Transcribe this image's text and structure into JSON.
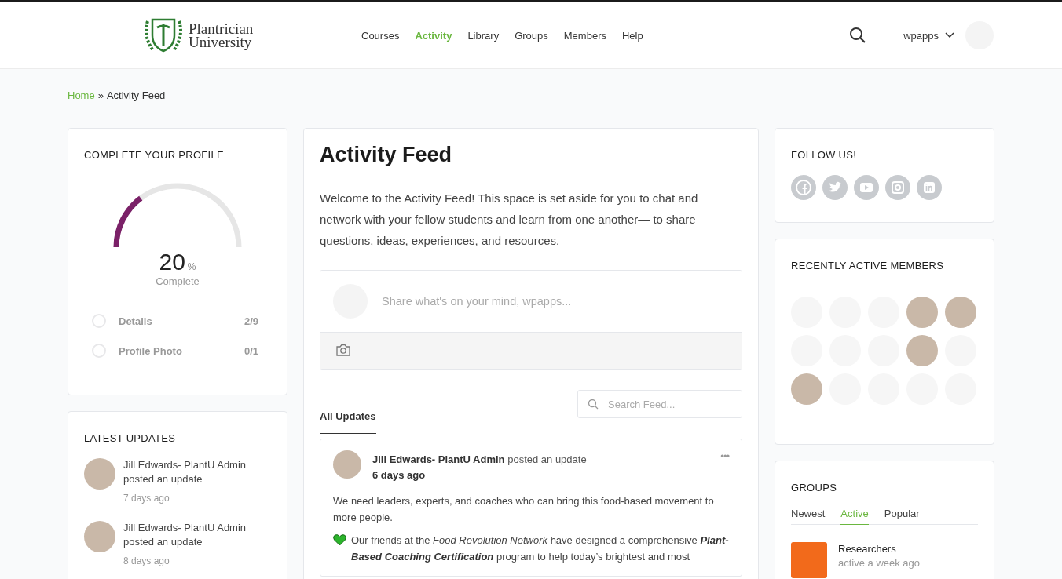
{
  "header": {
    "logo_line_1": "Plantrician",
    "logo_line_2": "University",
    "nav": [
      {
        "label": "Courses",
        "selected": false
      },
      {
        "label": "Activity",
        "selected": true
      },
      {
        "label": "Library",
        "selected": false
      },
      {
        "label": "Groups",
        "selected": false
      },
      {
        "label": "Members",
        "selected": false
      },
      {
        "label": "Help",
        "selected": false
      }
    ],
    "username": "wpapps"
  },
  "breadcrumb": {
    "home": "Home",
    "separator": "»",
    "current": "Activity Feed"
  },
  "profile_card": {
    "title": "COMPLETE YOUR PROFILE",
    "level": 0.2,
    "percent": "20",
    "percent_sign": "%",
    "caption": "Complete",
    "steps": [
      {
        "label": "Details",
        "count": "2/9",
        "done": false
      },
      {
        "label": "Profile Photo",
        "count": "0/1",
        "done": false
      }
    ]
  },
  "latest_updates": {
    "title": "LATEST UPDATES",
    "items": [
      {
        "name": "Jill Edwards- PlantU Admin",
        "action": "posted an update",
        "time": "7 days ago"
      },
      {
        "name": "Jill Edwards- PlantU Admin",
        "action": "posted an update",
        "time": "8 days ago"
      }
    ]
  },
  "feed": {
    "title": "Activity Feed",
    "intro": "Welcome to the Activity Feed! This space is set aside for you to chat and network with your fellow students and learn from one another— to share questions, ideas, experiences, and resources.",
    "composer_placeholder": "Share what's on your mind, wpapps...",
    "tabs": [
      {
        "label": "All Updates",
        "selected": true
      }
    ],
    "search_placeholder": "Search Feed...",
    "post": {
      "author": "Jill Edwards- PlantU Admin",
      "action": "posted an update",
      "time": "6 days ago",
      "more": "•••",
      "paragraphs": [
        "We need leaders, experts, and coaches who can bring this food-based movement to more people.",
        "Our friends at the *Food Revolution Network* have designed a comprehensive **Plant-Based Coaching Certification** program to help today’s brightest and most"
      ]
    }
  },
  "follow": {
    "title": "FOLLOW US!",
    "networks": [
      {
        "kind": "facebook"
      },
      {
        "kind": "twitter"
      },
      {
        "kind": "youtube"
      },
      {
        "kind": "instagram"
      },
      {
        "kind": "linkedin"
      }
    ]
  },
  "members": {
    "title": "RECENTLY ACTIVE MEMBERS",
    "items": [
      {
        "kind": "blank"
      },
      {
        "kind": "blank"
      },
      {
        "kind": "blank"
      },
      {
        "kind": "photo"
      },
      {
        "kind": "photo"
      },
      {
        "kind": "blank"
      },
      {
        "kind": "blank"
      },
      {
        "kind": "blank"
      },
      {
        "kind": "photo"
      },
      {
        "kind": "blank"
      },
      {
        "kind": "photo"
      },
      {
        "kind": "blank"
      },
      {
        "kind": "blank"
      },
      {
        "kind": "blank"
      },
      {
        "kind": "blank"
      }
    ]
  },
  "groups": {
    "title": "GROUPS",
    "tabs": [
      {
        "label": "Newest",
        "selected": false
      },
      {
        "label": "Active",
        "selected": true
      },
      {
        "label": "Popular",
        "selected": false
      }
    ],
    "items": [
      {
        "name": "Researchers",
        "meta": "active a week ago"
      }
    ]
  }
}
